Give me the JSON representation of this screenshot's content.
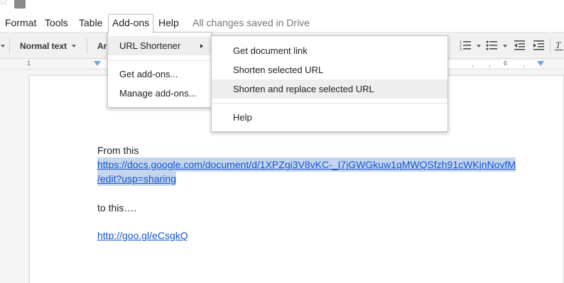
{
  "menubar": {
    "items": [
      "Format",
      "Tools",
      "Table",
      "Add-ons",
      "Help"
    ],
    "save_status": "All changes saved in Drive"
  },
  "toolbar": {
    "style_select": "Normal text",
    "font_select": "Ari"
  },
  "ruler": {
    "labels": [
      "1",
      "6"
    ]
  },
  "addons_menu": {
    "items": [
      {
        "label": "URL Shortener",
        "has_submenu": true
      },
      {
        "label": "Get add-ons..."
      },
      {
        "label": "Manage add-ons..."
      }
    ]
  },
  "url_shortener_submenu": {
    "items": [
      {
        "label": "Get document link"
      },
      {
        "label": "Shorten selected URL"
      },
      {
        "label": "Shorten and replace selected URL",
        "highlighted": true
      },
      {
        "label": "Help"
      }
    ]
  },
  "document": {
    "line1": "From this",
    "long_url_line1": "https://docs.google.com/document/d/1XPZgi3V8vKC-_I7jGWGkuw1qMWQSfzh91cWKjnNovfM",
    "long_url_line2": "/edit?usp=sharing",
    "line2": "to this….",
    "short_url": "http://goo.gl/eCsgkQ"
  },
  "colors": {
    "link": "#1155cc",
    "selection": "#c5d5ee",
    "menu_hover": "#eeeeee"
  }
}
